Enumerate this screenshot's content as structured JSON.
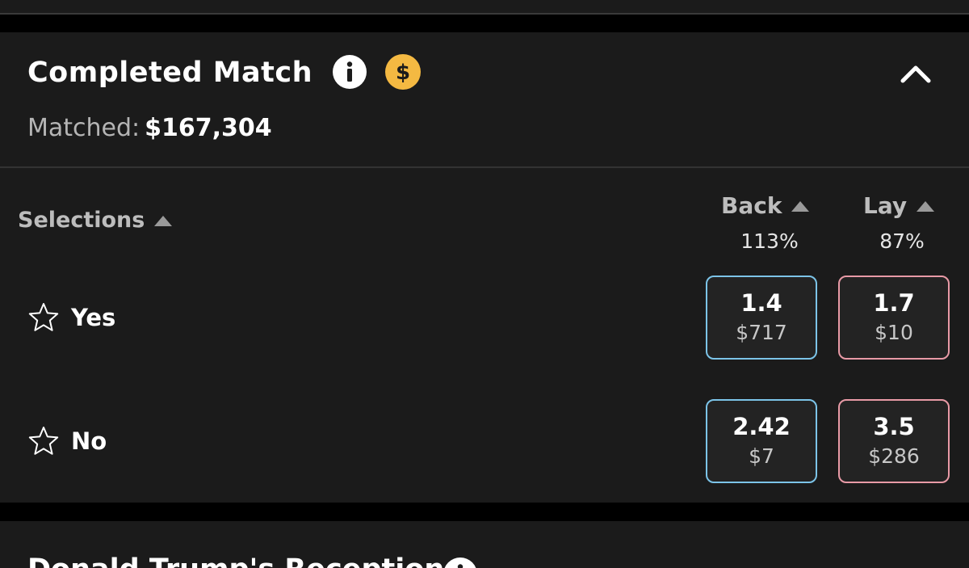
{
  "market": {
    "title": "Completed Match",
    "matched_label": "Matched:",
    "matched_value": "$167,304",
    "icons": {
      "info": "info-icon",
      "cash": "dollar-icon",
      "collapse": "chevron-up-icon"
    },
    "colors": {
      "back_border": "#7cc4e8",
      "lay_border": "#e89aa6",
      "cash_icon": "#f4b942"
    }
  },
  "columns": {
    "selections": "Selections",
    "back": {
      "label": "Back",
      "percent": "113%"
    },
    "lay": {
      "label": "Lay",
      "percent": "87%"
    }
  },
  "selections": [
    {
      "name": "Yes",
      "back": {
        "price": "1.4",
        "size": "$717"
      },
      "lay": {
        "price": "1.7",
        "size": "$10"
      }
    },
    {
      "name": "No",
      "back": {
        "price": "2.42",
        "size": "$7"
      },
      "lay": {
        "price": "3.5",
        "size": "$286"
      }
    }
  ],
  "next_market": {
    "title": "Donald Trump's Reception"
  }
}
